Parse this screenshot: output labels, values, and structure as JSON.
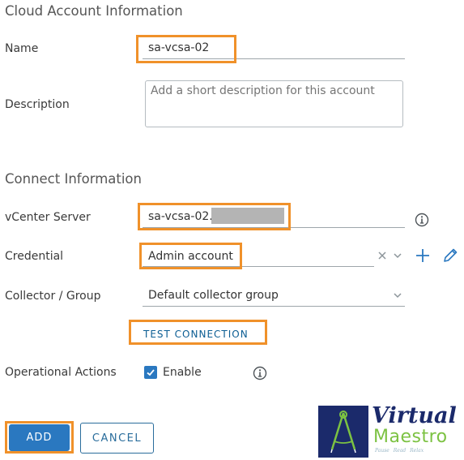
{
  "cloud_account": {
    "title": "Cloud Account Information",
    "name_label": "Name",
    "name_value": "sa-vcsa-02",
    "description_label": "Description",
    "description_placeholder": "Add a short description for this account"
  },
  "connect": {
    "title": "Connect Information",
    "vcenter_label": "vCenter Server",
    "vcenter_value": "sa-vcsa-02.",
    "credential_label": "Credential",
    "credential_value": "Admin account",
    "collector_label": "Collector / Group",
    "collector_value": "Default collector group",
    "test_connection_label": "TEST CONNECTION",
    "operational_label": "Operational Actions",
    "enable_label": "Enable",
    "enable_checked": true
  },
  "actions": {
    "add_label": "ADD",
    "cancel_label": "CANCEL"
  },
  "logo": {
    "line1": "Virtual",
    "line2": "Maestro",
    "tagline": "Pause  Read  Relax"
  },
  "colors": {
    "highlight": "#f0912a",
    "primary": "#2a78c0",
    "logo_navy": "#1b2a6b",
    "logo_green": "#7cc242"
  },
  "icons": {
    "info": "info-icon",
    "clear": "close-icon",
    "dropdown": "chevron-down-icon",
    "add": "plus-icon",
    "edit": "pencil-icon",
    "check": "check-icon"
  }
}
